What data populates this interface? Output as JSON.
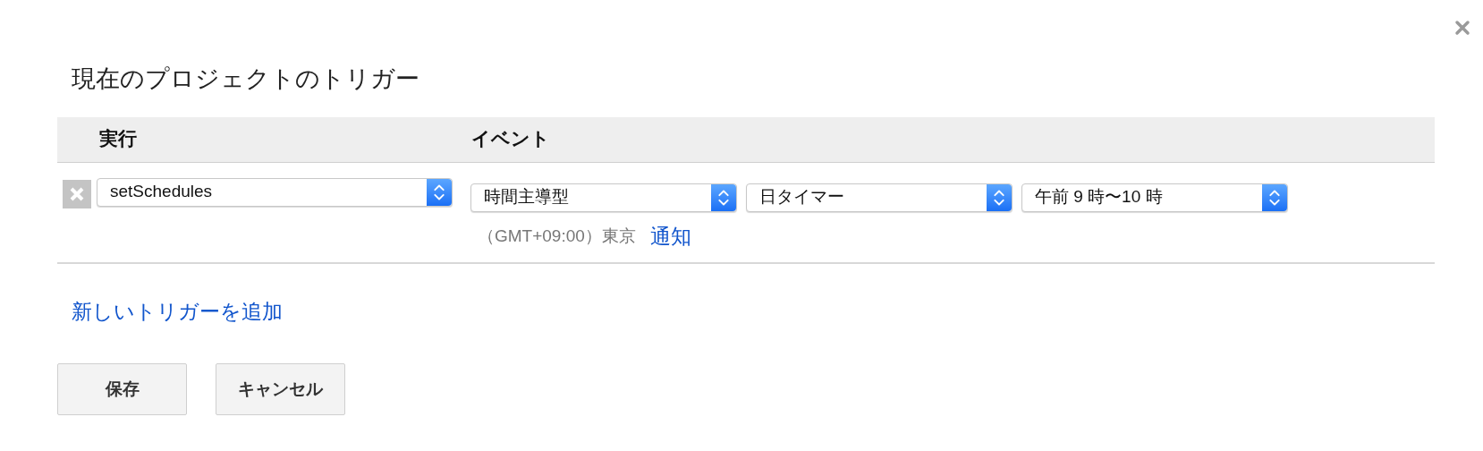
{
  "dialog": {
    "title": "現在のプロジェクトのトリガー"
  },
  "table": {
    "columns": [
      "実行",
      "イベント"
    ],
    "rows": [
      {
        "function": "setSchedules",
        "event_source": "時間主導型",
        "timer_type": "日タイマー",
        "time_range": "午前 9 時〜10 時",
        "timezone": "（GMT+09:00）東京",
        "notify_link": "通知"
      }
    ]
  },
  "add_trigger_link": "新しいトリガーを追加",
  "buttons": [
    "保存",
    "キャンセル"
  ]
}
